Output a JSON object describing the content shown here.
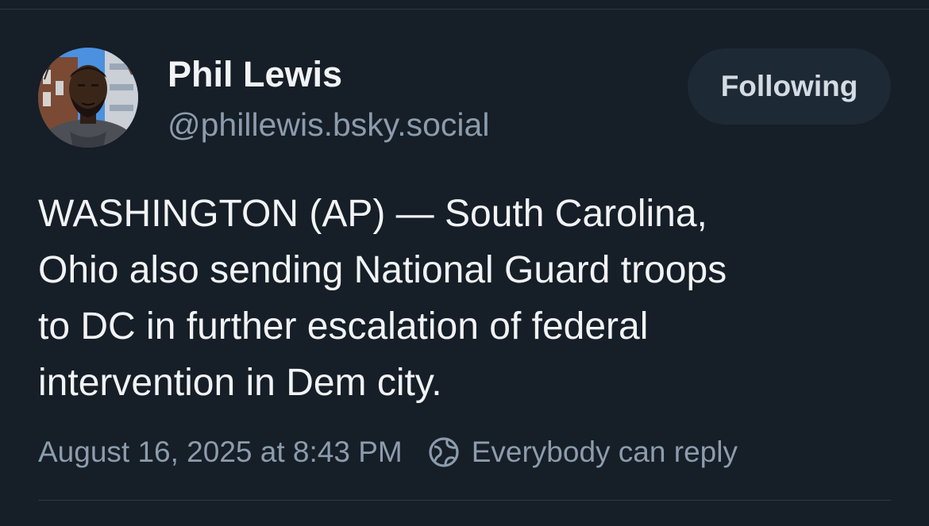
{
  "post": {
    "author": {
      "display_name": "Phil Lewis",
      "handle": "@phillewis.bsky.social"
    },
    "follow_button_label": "Following",
    "text": "WASHINGTON (AP) — South Carolina,\nOhio also sending National Guard troops\nto DC in further escalation of federal\nintervention in Dem city.",
    "timestamp": "August 16, 2025 at 8:43 PM",
    "reply_setting": "Everybody can reply"
  },
  "icons": {
    "reply_setting": "globe-icon",
    "avatar": "avatar-photo"
  },
  "colors": {
    "background": "#161e27",
    "primary_text": "#f1f3f5",
    "secondary_text": "#8c9cad",
    "button_background": "#1e2936",
    "divider": "#2e3a46"
  }
}
